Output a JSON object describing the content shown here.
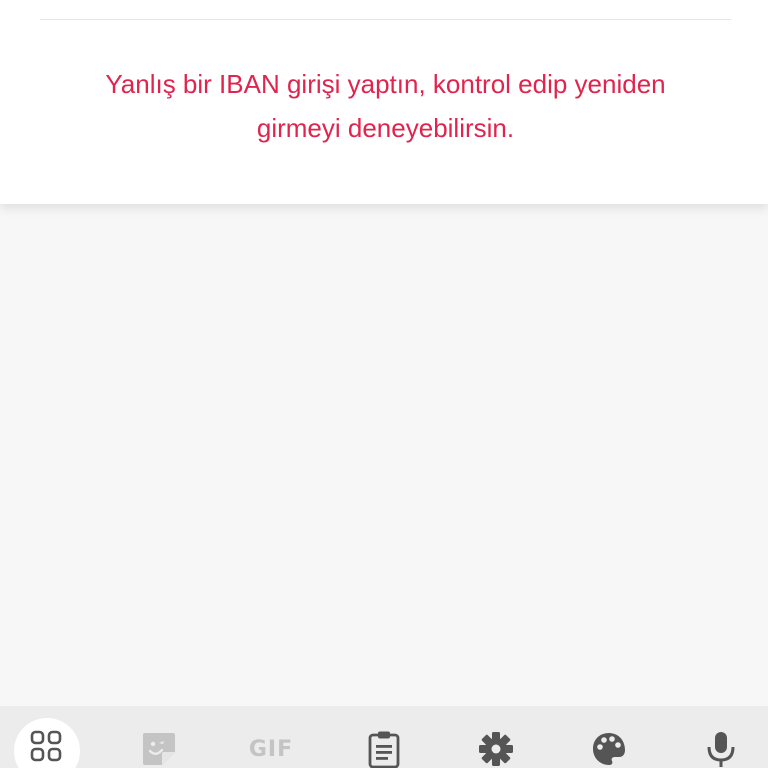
{
  "error": {
    "line1": "Yanlış bir IBAN girişi yaptın, kontrol edip yeniden",
    "line2": "girmeyi deneyebilirsin."
  },
  "toolbar": {
    "gif_label": "GIF",
    "icons": [
      "apps-grid-icon",
      "sticker-icon",
      "gif-icon",
      "clipboard-icon",
      "gear-icon",
      "palette-icon",
      "microphone-icon"
    ]
  },
  "colors": {
    "error": "#e0244d",
    "page_background": "#f7f7f7",
    "toolbar_background": "#ececec",
    "icon_dark": "#555555",
    "icon_light": "#c4c4c4"
  }
}
